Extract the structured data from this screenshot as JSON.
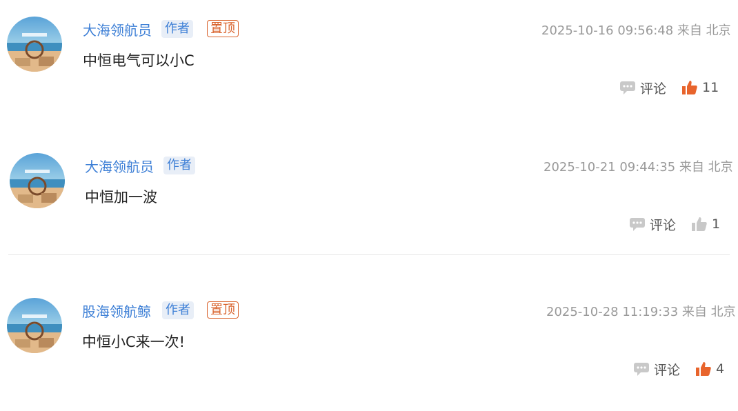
{
  "comments": [
    {
      "author": "大海领航员",
      "author_badge": "作者",
      "pinned_badge": "置顶",
      "meta": "2025-10-16 09:56:48 来自 北京",
      "text": "中恒电气可以小C",
      "reply_label": "评论",
      "likes": "11",
      "liked": true
    },
    {
      "author": "大海领航员",
      "author_badge": "作者",
      "pinned_badge": "",
      "meta": "2025-10-21 09:44:35 来自 北京",
      "text": "中恒加一波",
      "reply_label": "评论",
      "likes": "1",
      "liked": false
    },
    {
      "author": "股海领航鲸",
      "author_badge": "作者",
      "pinned_badge": "置顶",
      "meta": "2025-10-28 11:19:33 来自 北京",
      "text": "中恒小C来一次!",
      "reply_label": "评论",
      "likes": "4",
      "liked": true
    }
  ],
  "colors": {
    "author_blue": "#3d7fd6",
    "pin_orange": "#d9622b",
    "like_orange": "#e8642c",
    "like_gray": "#c8c8c8",
    "meta_gray": "#9a9a9a"
  },
  "icons": {
    "reply": "comment-bubble-icon",
    "like": "thumbs-up-icon"
  }
}
